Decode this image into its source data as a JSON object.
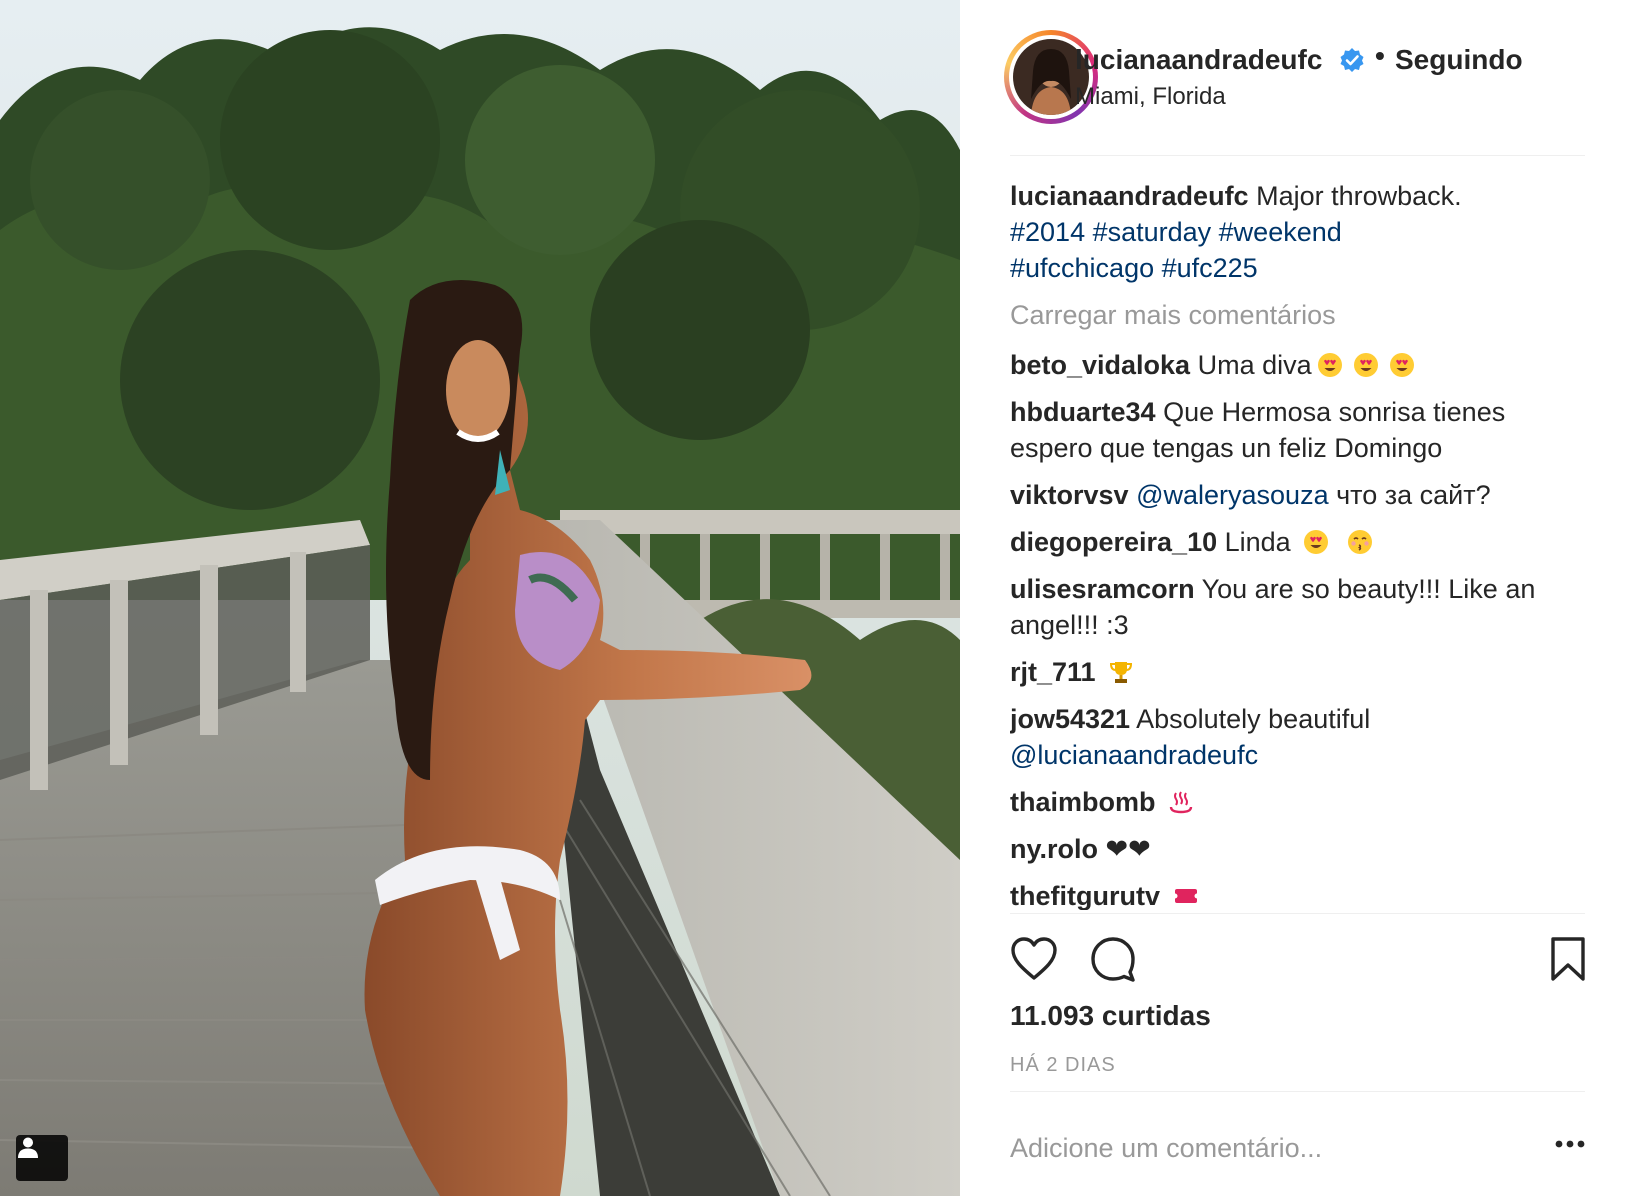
{
  "post": {
    "username": "lucianaandradeufc",
    "separator": "•",
    "follow_status": "Seguindo",
    "location": "Miami, Florida",
    "caption": {
      "username": "lucianaandradeufc",
      "text": "Major throwback.",
      "hashtags_line1": "#2014 #saturday #weekend",
      "hashtags_line2": "#ufcchicago #ufc225"
    },
    "load_more": "Carregar mais comentários",
    "comments": [
      {
        "user": "beto_vidaloka",
        "text": "Uma diva",
        "emojis": [
          "heart-eyes-emoji",
          "heart-eyes-emoji",
          "heart-eyes-emoji"
        ]
      },
      {
        "user": "hbduarte34",
        "text": "Que Hermosa sonrisa tienes espero que tengas un feliz Domingo"
      },
      {
        "user": "viktorvsv",
        "mention": "@waleryasouza",
        "text": "что за сайт?"
      },
      {
        "user": "diegopereira_10",
        "text": "Linda",
        "emojis": [
          "heart-eyes-emoji",
          "kissing-emoji"
        ]
      },
      {
        "user": "ulisesramcorn",
        "text": "You are so beauty!!! Like an angel!!! :3"
      },
      {
        "user": "rjt_711",
        "emojis": [
          "trophy-emoji"
        ]
      },
      {
        "user": "jow54321",
        "text": "Absolutely beautiful",
        "mention": "@lucianaandradeufc"
      },
      {
        "user": "thaimbomb",
        "emojis": [
          "hot-springs-emoji"
        ]
      },
      {
        "user": "ny.rolo",
        "text": "❤❤"
      },
      {
        "user": "thefitgurutv",
        "emojis": [
          "ticket-emoji"
        ]
      }
    ],
    "likes": "11.093 curtidas",
    "time_ago": "HÁ 2 DIAS",
    "add_comment_placeholder": "Adicione um comentário...",
    "more_label": "•••",
    "icons": {
      "like": "heart-outline-icon",
      "comment": "comment-bubble-icon",
      "save": "bookmark-icon",
      "tag": "user-tag-icon",
      "verified": "verified-badge-icon"
    },
    "colors": {
      "link": "#003569",
      "muted": "#999999",
      "text": "#262626",
      "verified": "#3897f0"
    }
  }
}
